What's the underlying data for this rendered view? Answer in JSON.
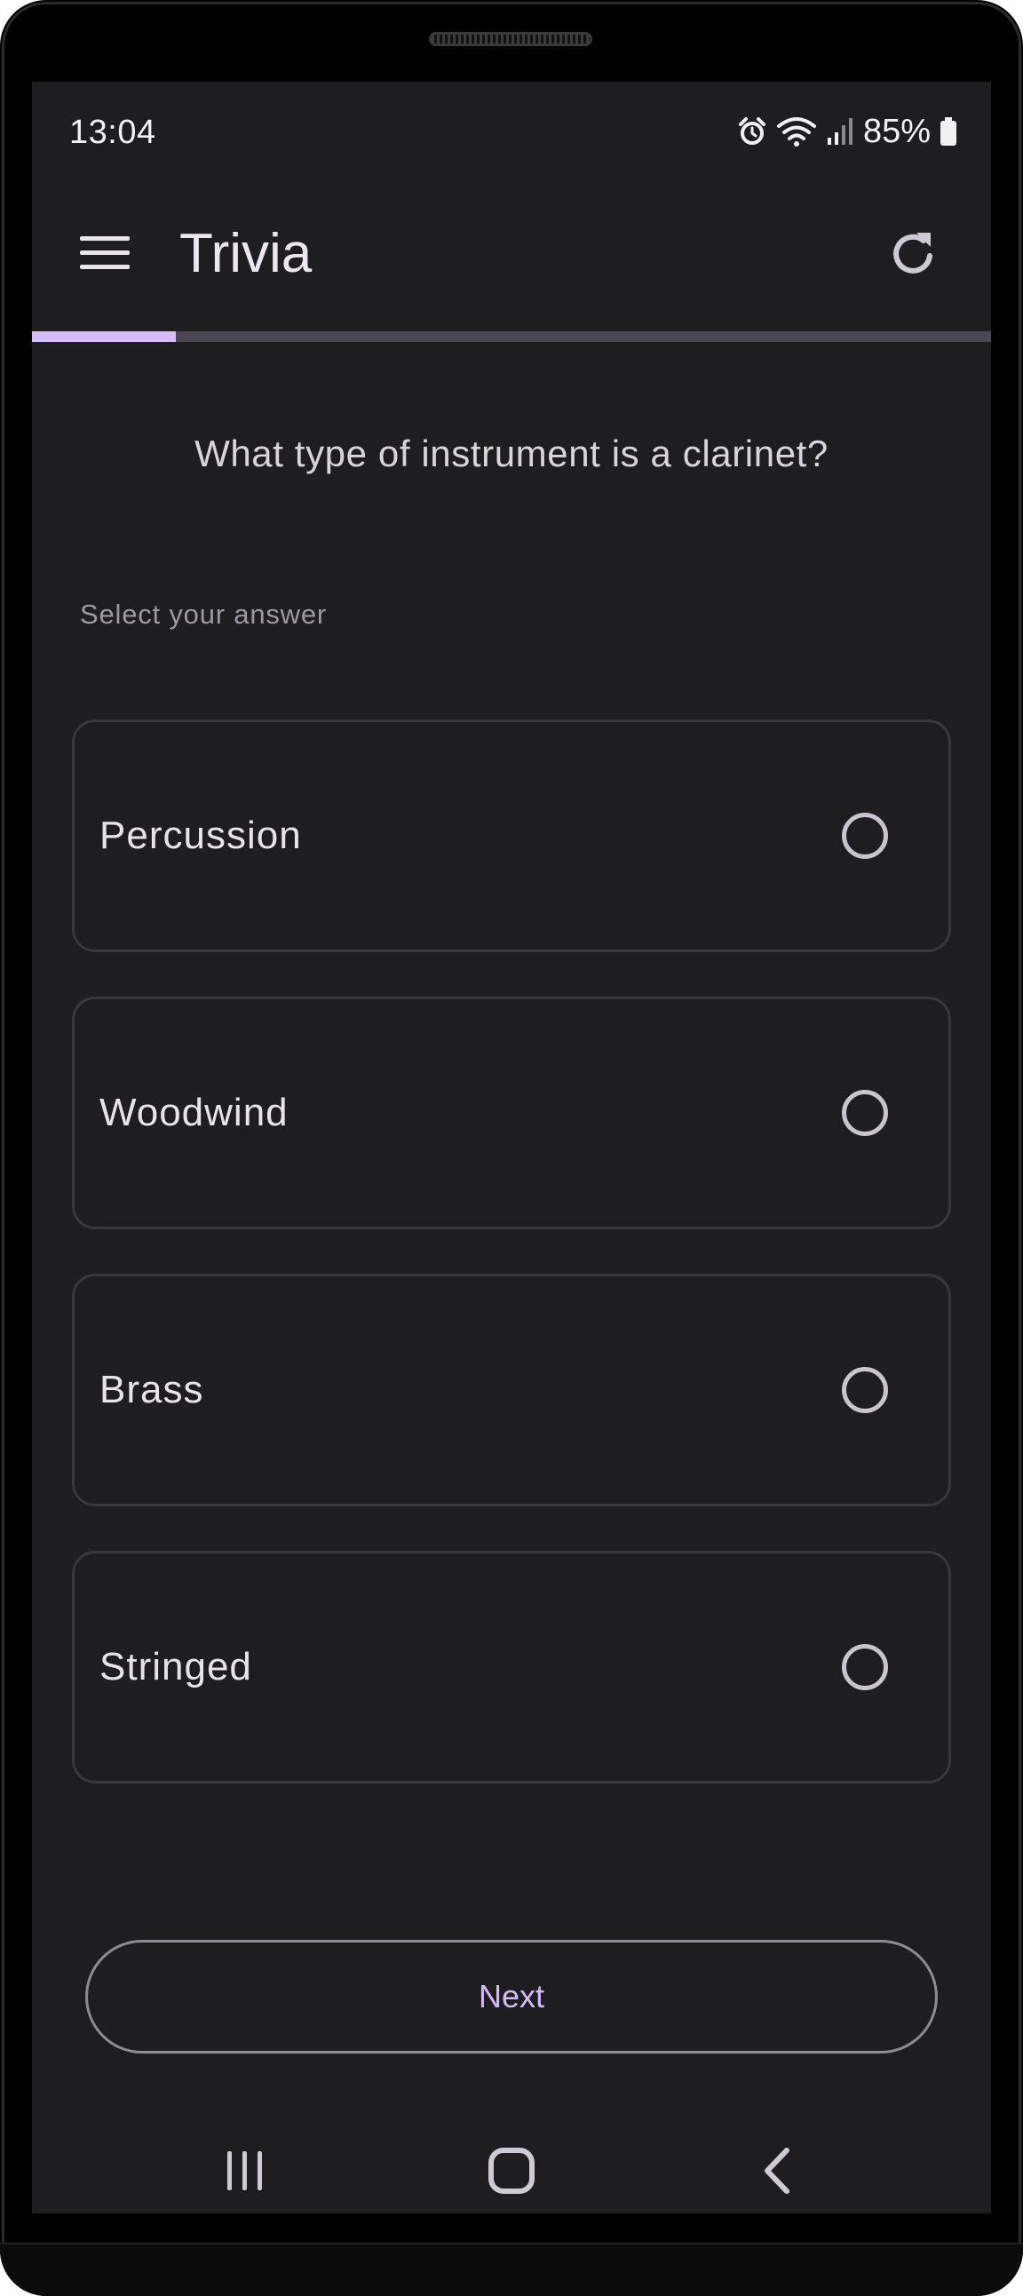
{
  "status_bar": {
    "time": "13:04",
    "battery_percent": "85%",
    "icons": [
      "alarm-icon",
      "wifi-icon",
      "signal-icon",
      "battery-icon"
    ]
  },
  "app_bar": {
    "title": "Trivia",
    "menu_icon": "menu-icon",
    "refresh_icon": "refresh-icon"
  },
  "progress": {
    "fraction": 0.15
  },
  "question": {
    "text": "What type of instrument is a clarinet?",
    "prompt": "Select your answer"
  },
  "options": [
    {
      "label": "Percussion",
      "selected": false
    },
    {
      "label": "Woodwind",
      "selected": false
    },
    {
      "label": "Brass",
      "selected": false
    },
    {
      "label": "Stringed",
      "selected": false
    }
  ],
  "next_button": {
    "label": "Next"
  },
  "navigation_bar": {
    "icons": [
      "recent-apps-icon",
      "home-icon",
      "back-icon"
    ]
  },
  "colors": {
    "background": "#1e1d20",
    "accent": "#d5bcf7",
    "progress_track": "#4a4752",
    "option_border": "#3a383d",
    "text_primary": "#e7e3ea",
    "text_secondary": "#9d99a2"
  }
}
